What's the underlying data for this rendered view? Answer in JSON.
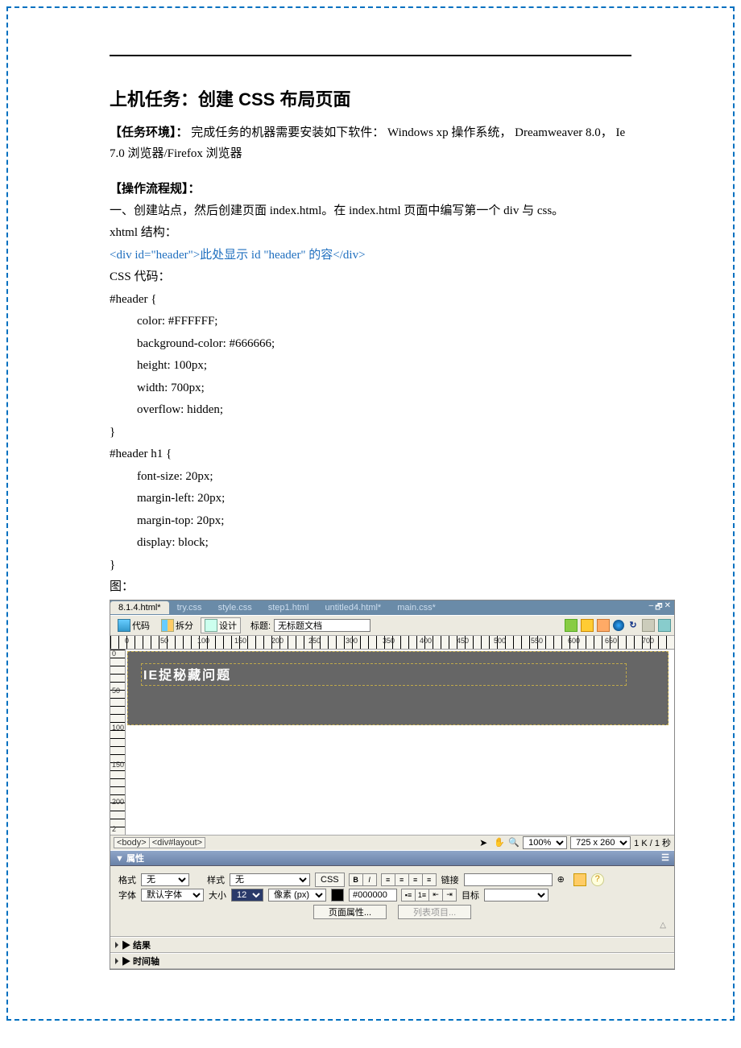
{
  "doc": {
    "title": "上机任务：创建 CSS 布局页面",
    "env_label": "【任务环境】：",
    "env_text": "  完成任务的机器需要安装如下软件：  Windows xp 操作系统，  Dreamweaver 8.0，  Ie 7.0 浏览器/Firefox  浏览器",
    "flow_label": "【操作流程规】：",
    "step1": "一、创建站点，然后创建页面 index.html。在 index.html 页面中编写第一个 div 与 css。",
    "xhtml_label": "xhtml 结构：",
    "xhtml_code": "<div id=\"header\">此处显示   id \"header\"  的容</div>",
    "css_label": "CSS 代码：",
    "css_lines": [
      "#header {",
      "color: #FFFFFF;",
      "background-color: #666666;",
      "height: 100px;",
      "width: 700px;",
      "overflow: hidden;",
      "}",
      "",
      "#header h1 {",
      "font-size: 20px;",
      "margin-left: 20px;",
      "margin-top: 20px;",
      "display: block;",
      "}"
    ],
    "fig_label": "图："
  },
  "dw": {
    "tabs": [
      "8.1.4.html*",
      "try.css",
      "style.css",
      "step1.html",
      "untitled4.html*",
      "main.css*"
    ],
    "winctl": [
      "–",
      "🗗",
      "✕"
    ],
    "tb": {
      "code": "代码",
      "split": "拆分",
      "design": "设计",
      "title_label": "标题:",
      "title_value": "无标题文档"
    },
    "hticks": [
      "0",
      "50",
      "100",
      "150",
      "200",
      "250",
      "300",
      "350",
      "400",
      "450",
      "500",
      "550",
      "600",
      "650",
      "700"
    ],
    "vticks": [
      "0",
      "50",
      "100",
      "150",
      "200",
      "2"
    ],
    "canvas_h1": "IE捉秘藏问题",
    "tagsel": [
      "<body>",
      "<div#layout>"
    ],
    "status": {
      "zoom": "100%",
      "dims": "725 x 260",
      "size": "1 K / 1 秒"
    },
    "panels": {
      "props_title": "▼ 属性",
      "format_label": "格式",
      "format_value": "无",
      "style_label": "样式",
      "style_value": "无",
      "css_btn": "CSS",
      "link_label": "链接",
      "font_label": "字体",
      "font_value": "默认字体",
      "size_label": "大小",
      "size_value": "12",
      "unit_value": "像素 (px)",
      "color_value": "#000000",
      "target_label": "目标",
      "pageprops_btn": "页面属性...",
      "listitem_btn": "列表项目...",
      "results": "▶ 结果",
      "timeline": "▶ 时间轴"
    }
  }
}
